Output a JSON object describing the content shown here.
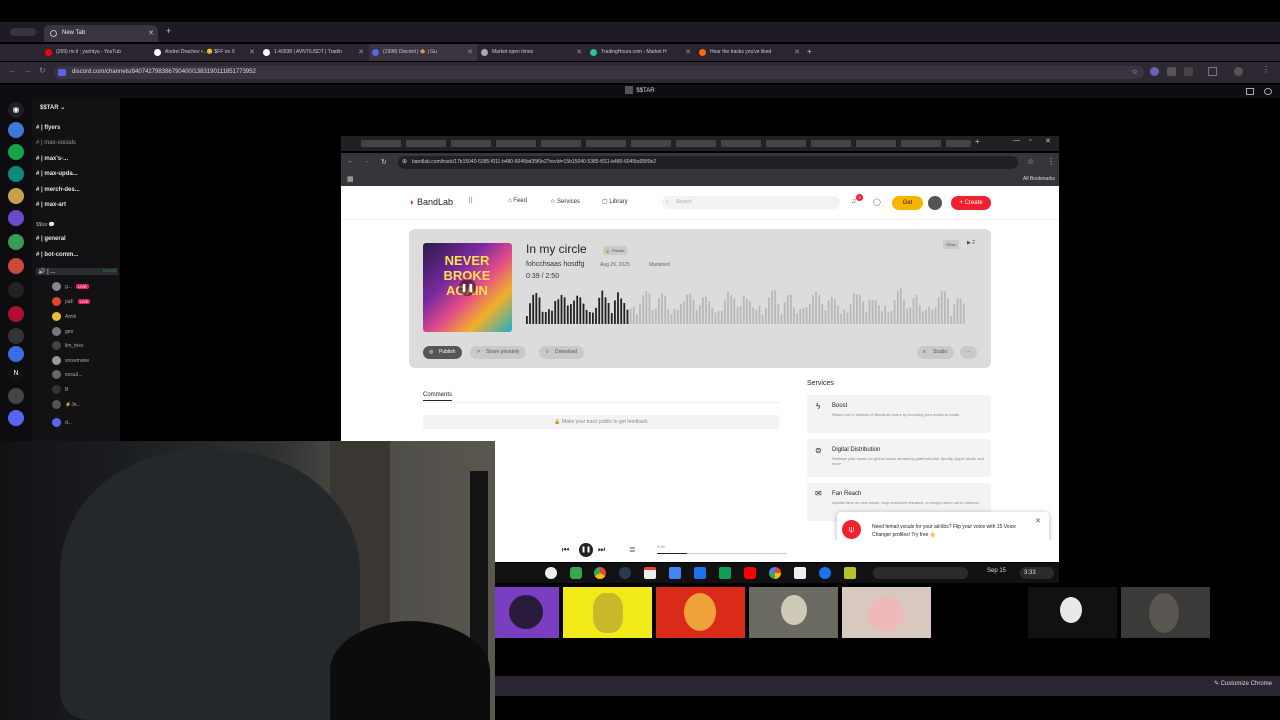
{
  "outer_browser": {
    "active_tab": "New Tab",
    "tabs": [
      {
        "label": "(269) rio li ; yachtyu - YouTub",
        "color": "#ff0000"
      },
      {
        "label": "Andrei Drachev •...😊 $FF on X",
        "color": "#ffffff"
      },
      {
        "label": "1.40938 | AVNT/USDT | Tradin",
        "color": "#ffffff"
      },
      {
        "label": "(1998) Discord | 🐵 | Gu",
        "color": "#5865f2"
      },
      {
        "label": "Market open times",
        "color": "#aaaaaa"
      },
      {
        "label": "TradingHours.com - Market H",
        "color": "#27c19c"
      },
      {
        "label": "Hear the tracks you've liked",
        "color": "#ff6a00"
      }
    ],
    "url": "discord.com/channels/840742798386790400/1383190111851773952",
    "customize_label": "Customize Chrome"
  },
  "discord": {
    "window_title": "$$TAR",
    "server_name": "$$TAR",
    "channels": [
      {
        "label": "| flyers"
      },
      {
        "label": "| max-socials"
      },
      {
        "label": "| max's-..."
      },
      {
        "label": "| max-upda..."
      },
      {
        "label": "| merch-des..."
      },
      {
        "label": "| max-art"
      }
    ],
    "category": "$$tar 💬",
    "channels2": [
      {
        "label": "| general"
      },
      {
        "label": "| bot-comm..."
      },
      {
        "label": "| ..."
      }
    ],
    "voice_time": "9:37:05",
    "voice_users": [
      {
        "name": "g...",
        "live": true,
        "color": "#888888"
      },
      {
        "name": "paF",
        "live": true,
        "color": "#e0452a"
      },
      {
        "name": "Amiri",
        "live": false,
        "color": "#e8c030"
      },
      {
        "name": "geo",
        "live": false,
        "color": "#777777"
      },
      {
        "name": "lim_trixx",
        "live": false,
        "color": "#444444"
      },
      {
        "name": "snowmane",
        "live": false,
        "color": "#999999"
      },
      {
        "name": "sosa3...",
        "live": false,
        "color": "#666666"
      },
      {
        "name": "B",
        "live": false,
        "color": "#333333"
      },
      {
        "name": "⚡Je...",
        "live": false,
        "color": "#555555"
      }
    ],
    "bottom_user": "d...",
    "live_label": "LIVE"
  },
  "inner_browser": {
    "url": "bandlab.com/track/17b15040-5385-f011-b480-6045bd35f0e2?revId=15b15040-5385-f011-b480-6045bd35f0e2",
    "all_bookmarks": "All Bookmarks"
  },
  "bandlab": {
    "logo": "BandLab",
    "nav": {
      "feed": "Feed",
      "services": "Services",
      "library": "Library"
    },
    "search_placeholder": "Search",
    "notification_count": "9",
    "get_label": "Get",
    "create_label": "+ Create",
    "track": {
      "title": "In my circle",
      "privacy": "Private",
      "artist": "fohcchsaas hosdfg",
      "date": "Aug 29, 2025",
      "status": "Mastered",
      "time": "0:39 /  2:50",
      "genre": "Other",
      "plays": "2",
      "progress": 0.23,
      "cover_text": "NEVER BROKE AGAIN"
    },
    "actions": {
      "publish": "Publish",
      "share": "Share privately",
      "download": "Download",
      "studio": "Studio"
    },
    "comments_tab": "Comments",
    "comments_note": "Make your track public to get feedback",
    "services_title": "Services",
    "services": [
      {
        "title": "Boost",
        "desc": "Reach out to millions of BandLab users by boosting your music or posts"
      },
      {
        "title": "Digital Distribution",
        "desc": "Release your music on global music streaming platforms like Spotify, Apple Music and more"
      },
      {
        "title": "Fan Reach",
        "desc": "Update fans on new music, drop exclusive releases, or simply reach out to connect"
      }
    ],
    "popup": "Need femail vocals for your ad-libs? Flip your voice with 15 Voice Changer profiles! Try free 👆",
    "player_time": "0:39"
  },
  "os_shelf": {
    "date": "Sep 15",
    "time": "3:33"
  }
}
